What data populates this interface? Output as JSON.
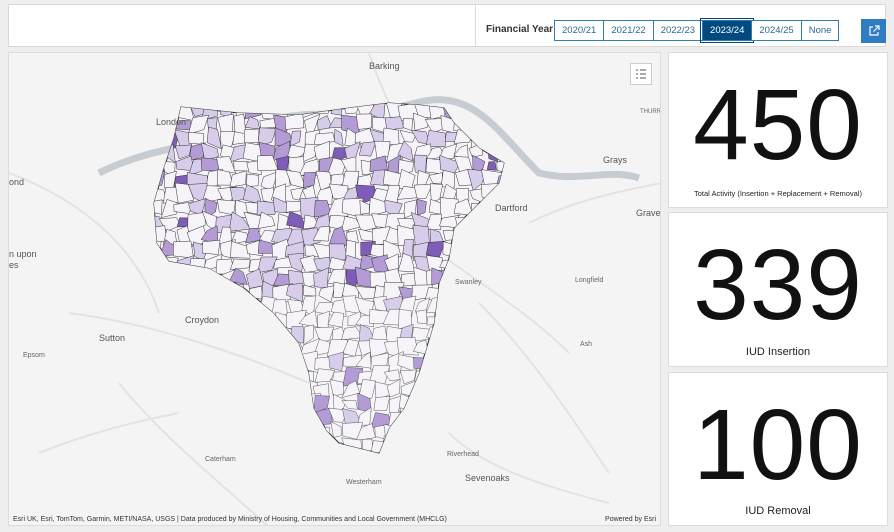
{
  "header": {
    "financial_year_label": "Financial Year",
    "years": [
      {
        "label": "2020/21",
        "selected": false
      },
      {
        "label": "2021/22",
        "selected": false
      },
      {
        "label": "2022/23",
        "selected": false
      },
      {
        "label": "2023/24",
        "selected": true
      },
      {
        "label": "2024/25",
        "selected": false
      },
      {
        "label": "None",
        "selected": false
      }
    ],
    "share_icon": "external-link-icon"
  },
  "map": {
    "places": [
      "Barking",
      "London",
      "Grays",
      "Dartford",
      "Graves",
      "Swanley",
      "Longfield",
      "Croydon",
      "Sutton",
      "Ash",
      "Epsom",
      "Caterham",
      "Riverhead",
      "Sevenoaks",
      "Westerham",
      "THURR",
      "ond",
      "n upon",
      "es"
    ],
    "legend_icon": "legend-list-icon",
    "attribution": "Esri UK, Esri, TomTom, Garmin, METI/NASA, USGS | Data produced by Ministry of Housing, Communities and Local Government (MHCLG)",
    "powered_by": "Powered by Esri",
    "colors": {
      "background": "#f4f4f4",
      "region_fill": "#f6f4f9",
      "light": "#d8cceb",
      "mid": "#b39bd6",
      "dark": "#7d5db8",
      "boundary": "#333333",
      "river": "#c6ccd2"
    }
  },
  "kpis": [
    {
      "value": "450",
      "label": "Total Activity (Insertion + Replacement + Removal)"
    },
    {
      "value": "339",
      "label": "IUD Insertion"
    },
    {
      "value": "100",
      "label": "IUD Removal"
    }
  ]
}
